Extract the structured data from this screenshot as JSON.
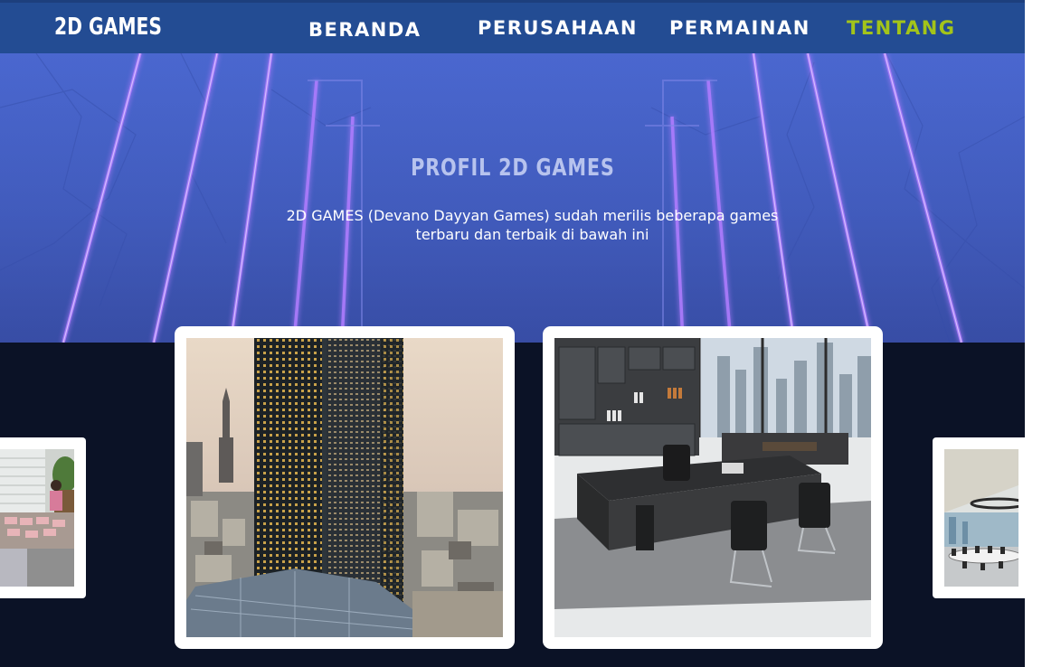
{
  "nav": {
    "logo": "2D GAMES",
    "links": [
      {
        "label": "BERANDA",
        "active": false
      },
      {
        "label": "PERUSAHAAN",
        "active": false
      },
      {
        "label": "PERMAINAN",
        "active": false
      },
      {
        "label": "TENTANG",
        "active": true
      }
    ],
    "active_color": "#a3c41a",
    "bar_color": "#234c93"
  },
  "hero": {
    "title": "PROFIL 2D GAMES",
    "description": "2D GAMES (Devano Dayyan Games) sudah merilis beberapa games terbaru dan terbaik di bawah ini",
    "background_color": "#4a67cf",
    "neon_color": "#a36dff"
  },
  "gallery": {
    "images": [
      {
        "name": "office-workspace-photo"
      },
      {
        "name": "skyscraper-towers-photo"
      },
      {
        "name": "executive-office-photo"
      },
      {
        "name": "conference-room-photo"
      }
    ],
    "background_color": "#0b1226"
  }
}
